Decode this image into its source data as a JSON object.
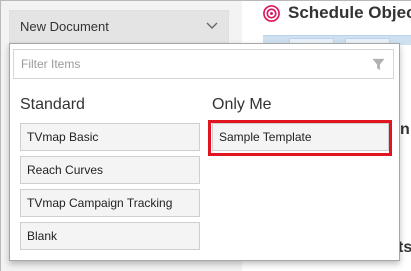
{
  "background": {
    "document_select": "New Document",
    "object_title": "Schedule Objec",
    "right_fragment_1": "n",
    "right_fragment_2": "ts"
  },
  "dropdown": {
    "filter_placeholder": "Filter Items",
    "columns": [
      {
        "heading": "Standard",
        "items": [
          "TVmap Basic",
          "Reach Curves",
          "TVmap Campaign Tracking",
          "Blank"
        ]
      },
      {
        "heading": "Only Me",
        "items": [
          "Sample Template"
        ]
      }
    ],
    "highlighted_item": "Sample Template"
  },
  "colors": {
    "highlight": "#e0151f",
    "target_icon": "#d81b60"
  },
  "icons": [
    "chevron-down-icon",
    "target-icon",
    "funnel-icon"
  ]
}
